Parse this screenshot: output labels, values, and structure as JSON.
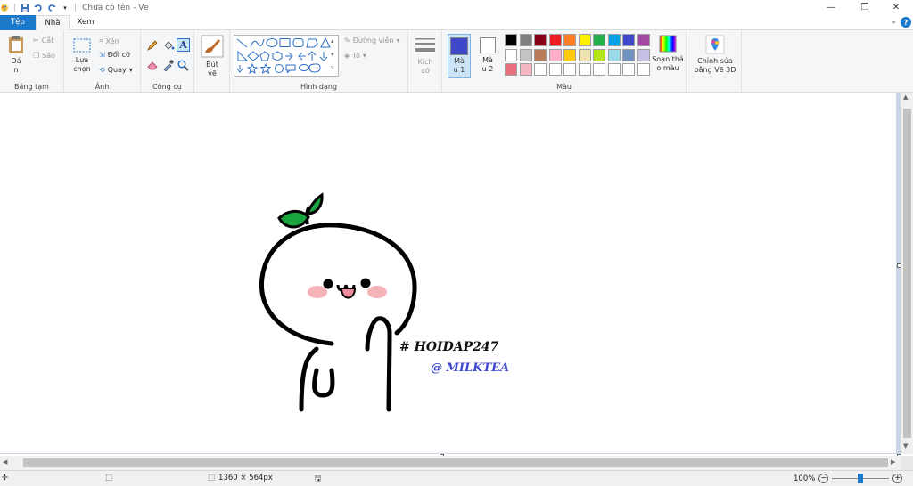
{
  "window": {
    "title": "Chưa có tên - Vẽ",
    "controls": {
      "minimize": "—",
      "restore": "❐",
      "close": "✕"
    }
  },
  "tabs": [
    "Tệp",
    "Nhà",
    "Xem"
  ],
  "help": "?",
  "ribbon": {
    "clipboard": {
      "paste": "Dá\nn",
      "cut": "Cắt",
      "copy": "Sao",
      "label": "Bảng tạm"
    },
    "image": {
      "select": "Lựa\nchọn",
      "crop": "Xén",
      "resize": "Đổi cỡ",
      "rotate": "Quay",
      "label": "Ảnh"
    },
    "tools": {
      "label": "Công cụ"
    },
    "brushes": {
      "label": "Bút\nvẽ"
    },
    "shapes": {
      "outline": "Đường viền",
      "fill": "Tô",
      "label": "Hình dạng"
    },
    "size": {
      "label": "Kích\ncỡ"
    },
    "colors": {
      "color1": "Mà\nu 1",
      "color2": "Mà\nu 2",
      "color1_value": "#3f48cc",
      "color2_value": "#ffffff",
      "palette_row1": [
        "#000000",
        "#7f7f7f",
        "#880015",
        "#ed1c24",
        "#ff7f27",
        "#fff200",
        "#22b14c",
        "#00a2e8",
        "#3f48cc",
        "#a349a4"
      ],
      "palette_row2": [
        "#ffffff",
        "#c3c3c3",
        "#b97a57",
        "#ffaec9",
        "#ffc90e",
        "#efe4b0",
        "#b5e61d",
        "#99d9ea",
        "#7092be",
        "#c8bfe7"
      ],
      "palette_row3": [
        "#e8707e",
        "#f4b6c2",
        "#ffffff",
        "#ffffff",
        "#ffffff",
        "#ffffff",
        "#ffffff",
        "#ffffff",
        "#ffffff",
        "#ffffff"
      ],
      "edit_colors": "Soạn thả\no màu",
      "label": "Màu"
    },
    "paint3d": "Chỉnh sửa\nbằng Vẽ 3D"
  },
  "canvas": {
    "hashtag": "# HOIDAP247",
    "credit": "@ MILKTEA"
  },
  "status": {
    "dimensions": "1360 × 564px",
    "zoom": "100%",
    "zoom_level_fraction": 0.5
  }
}
